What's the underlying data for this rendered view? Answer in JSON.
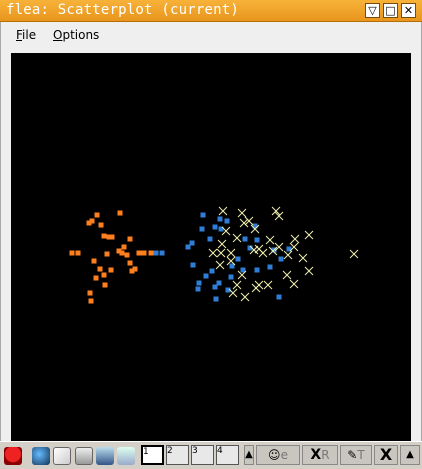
{
  "window": {
    "title": "flea: Scatterplot (current)",
    "buttons": {
      "shade": "▽",
      "maximize": "□",
      "close": "✕"
    }
  },
  "menu": [
    {
      "label": "File",
      "mnemonic": "F"
    },
    {
      "label": "Options",
      "mnemonic": "O"
    }
  ],
  "colors": {
    "title_bar": "#f0a22e",
    "plot_bg": "#000000",
    "series_orange": "#ff7f1e",
    "series_blue": "#2f7ed8",
    "series_cream": "#f2efb0"
  },
  "plot": {
    "axis_range": {
      "x": [
        0,
        400
      ],
      "y": [
        0,
        400
      ]
    },
    "series": [
      {
        "color": "#ff7f1e",
        "marker": "square",
        "points": [
          [
            78,
            170
          ],
          [
            81,
            168
          ],
          [
            86,
            162
          ],
          [
            90,
            172
          ],
          [
            93,
            183
          ],
          [
            98,
            184
          ],
          [
            101,
            184
          ],
          [
            109,
            160
          ],
          [
            113,
            194
          ],
          [
            116,
            202
          ],
          [
            119,
            210
          ],
          [
            121,
            218
          ],
          [
            124,
            216
          ],
          [
            119,
            186
          ],
          [
            111,
            200
          ],
          [
            96,
            201
          ],
          [
            61,
            200
          ],
          [
            67,
            200
          ],
          [
            83,
            208
          ],
          [
            85,
            225
          ],
          [
            89,
            216
          ],
          [
            93,
            222
          ],
          [
            100,
            217
          ],
          [
            108,
            198
          ],
          [
            128,
            200
          ],
          [
            133,
            200
          ],
          [
            140,
            200
          ],
          [
            145,
            200
          ],
          [
            94,
            232
          ],
          [
            79,
            240
          ],
          [
            80,
            248
          ]
        ]
      },
      {
        "color": "#2f7ed8",
        "marker": "square",
        "points": [
          [
            145,
            200
          ],
          [
            151,
            200
          ],
          [
            177,
            194
          ],
          [
            181,
            190
          ],
          [
            191,
            176
          ],
          [
            192,
            162
          ],
          [
            204,
            174
          ],
          [
            209,
            166
          ],
          [
            216,
            168
          ],
          [
            210,
            176
          ],
          [
            199,
            186
          ],
          [
            201,
            218
          ],
          [
            182,
            212
          ],
          [
            188,
            230
          ],
          [
            187,
            236
          ],
          [
            205,
            246
          ],
          [
            204,
            234
          ],
          [
            208,
            230
          ],
          [
            217,
            237
          ],
          [
            220,
            224
          ],
          [
            221,
            213
          ],
          [
            227,
            206
          ],
          [
            232,
            217
          ],
          [
            234,
            186
          ],
          [
            239,
            195
          ],
          [
            244,
            173
          ],
          [
            246,
            187
          ],
          [
            246,
            217
          ],
          [
            270,
            206
          ],
          [
            263,
            197
          ],
          [
            259,
            214
          ],
          [
            268,
            244
          ],
          [
            278,
            196
          ],
          [
            195,
            223
          ]
        ]
      },
      {
        "color": "#f2efb0",
        "marker": "x",
        "points": [
          [
            212,
            158
          ],
          [
            215,
            178
          ],
          [
            211,
            191
          ],
          [
            210,
            200
          ],
          [
            220,
            200
          ],
          [
            231,
            160
          ],
          [
            233,
            170
          ],
          [
            238,
            168
          ],
          [
            244,
            176
          ],
          [
            226,
            185
          ],
          [
            243,
            197
          ],
          [
            248,
            196
          ],
          [
            252,
            200
          ],
          [
            262,
            198
          ],
          [
            259,
            187
          ],
          [
            265,
            158
          ],
          [
            268,
            163
          ],
          [
            277,
            202
          ],
          [
            268,
            194
          ],
          [
            276,
            222
          ],
          [
            283,
            194
          ],
          [
            284,
            186
          ],
          [
            292,
            205
          ],
          [
            298,
            182
          ],
          [
            298,
            218
          ],
          [
            283,
            231
          ],
          [
            226,
            232
          ],
          [
            231,
            222
          ],
          [
            234,
            244
          ],
          [
            222,
            240
          ],
          [
            220,
            208
          ],
          [
            209,
            212
          ],
          [
            202,
            200
          ],
          [
            245,
            235
          ],
          [
            248,
            232
          ],
          [
            257,
            232
          ],
          [
            343,
            201
          ]
        ]
      }
    ]
  },
  "taskbar": {
    "pagers": [
      "1",
      "2",
      "3",
      "4"
    ],
    "tasks": [
      "X",
      "R",
      "T"
    ],
    "task_labels": [
      "e",
      "R",
      "T"
    ]
  }
}
